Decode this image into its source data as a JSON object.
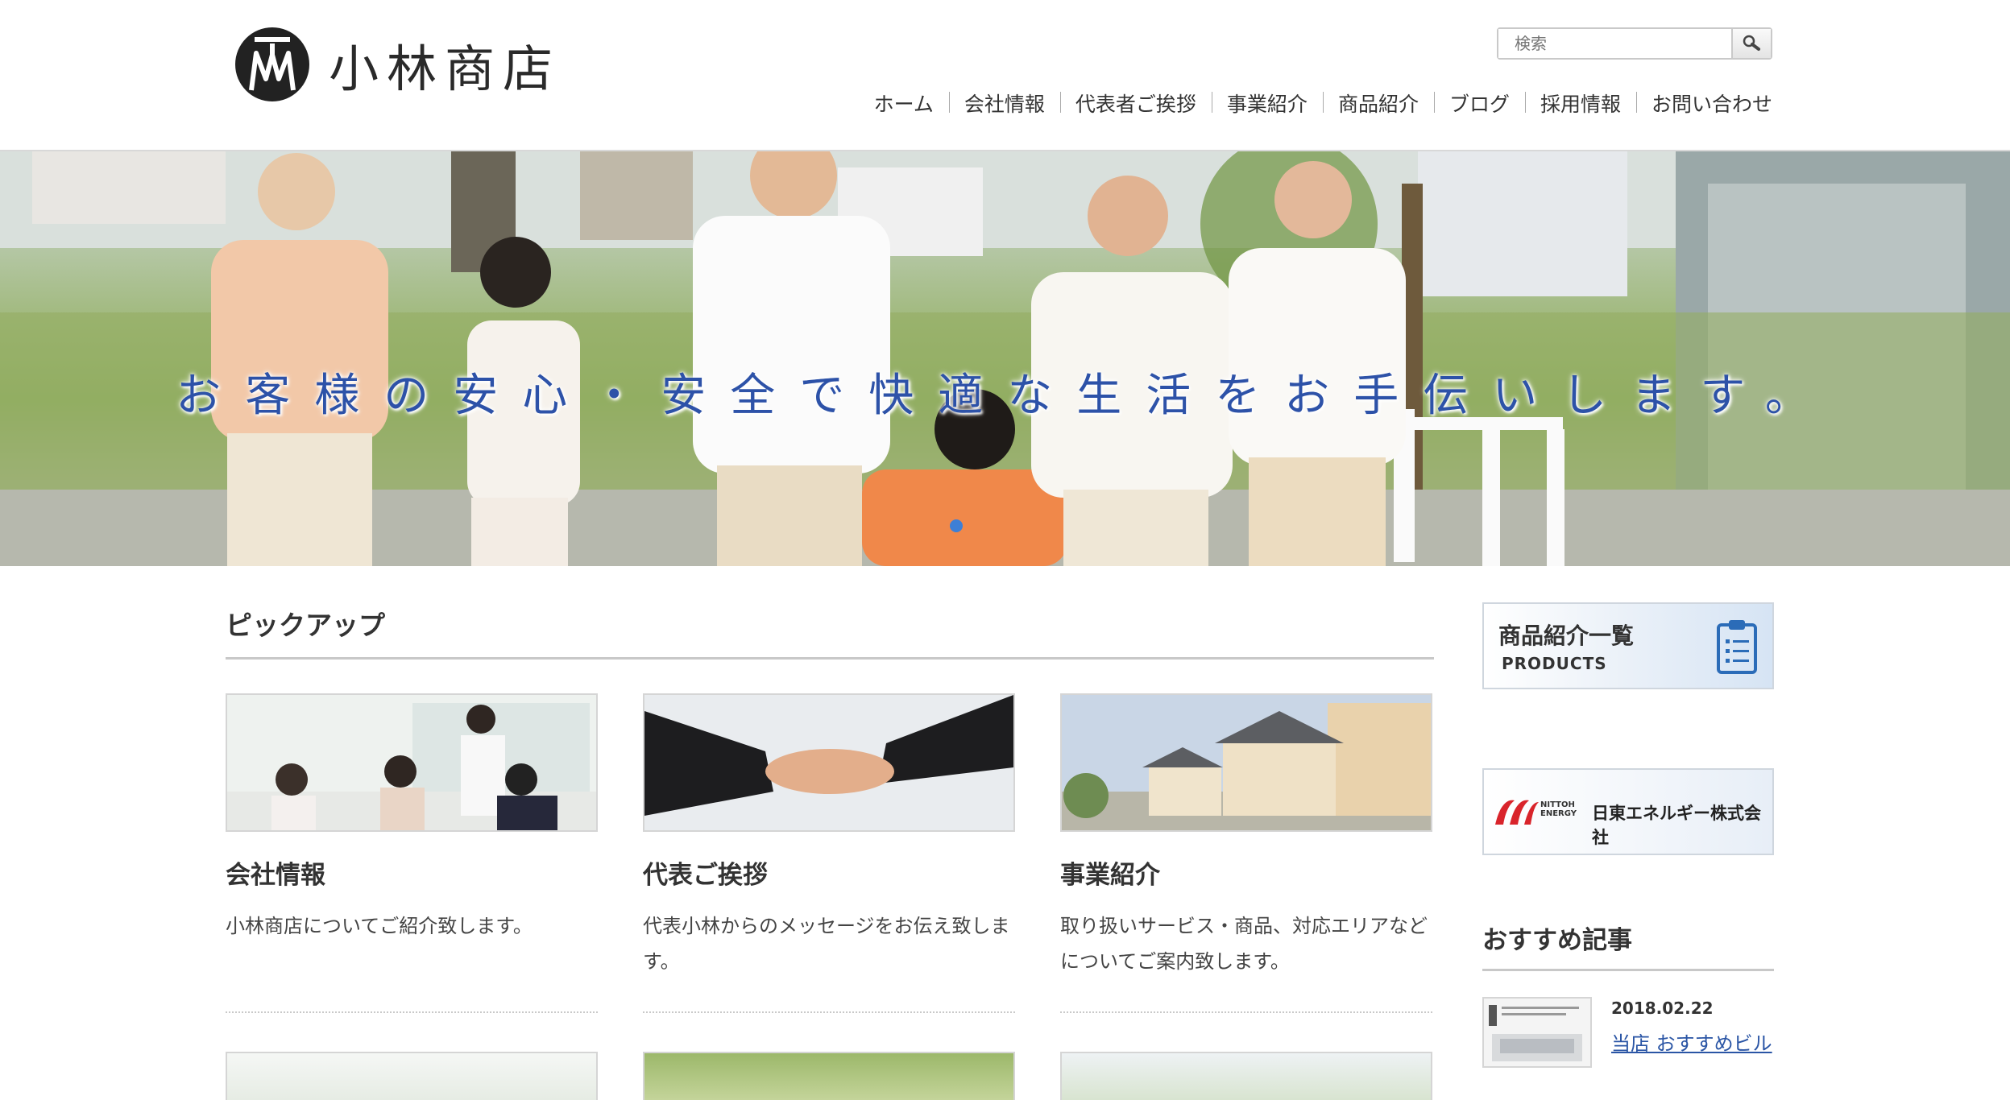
{
  "header": {
    "logo_text": "小林商店",
    "search": {
      "placeholder": "検索"
    },
    "nav": [
      "ホーム",
      "会社情報",
      "代表者ご挨拶",
      "事業紹介",
      "商品紹介",
      "ブログ",
      "採用情報",
      "お問い合わせ"
    ]
  },
  "hero": {
    "caption": "お客様の安心・安全で快適な生活をお手伝いします。"
  },
  "pickup": {
    "title": "ピックアップ",
    "cards": [
      {
        "title": "会社情報",
        "desc": "小林商店についてご紹介致します。"
      },
      {
        "title": "代表ご挨拶",
        "desc": "代表小林からのメッセージをお伝え致します。"
      },
      {
        "title": "事業紹介",
        "desc": "取り扱いサービス・商品、対応エリアなどについてご案内致します。"
      }
    ]
  },
  "sidebar": {
    "banner1": {
      "title": "商品紹介一覧",
      "subtitle": "PRODUCTS"
    },
    "banner2": {
      "small": "NITTOH ENERGY",
      "name": "日東エネルギー株式会社"
    },
    "recommend_title": "おすすめ記事",
    "post": {
      "date": "2018.02.22",
      "title": "当店 おすすめビル"
    }
  },
  "colors": {
    "caption": "#2d52a8",
    "link": "#2a55a5",
    "dot": "#3d7fd6"
  }
}
